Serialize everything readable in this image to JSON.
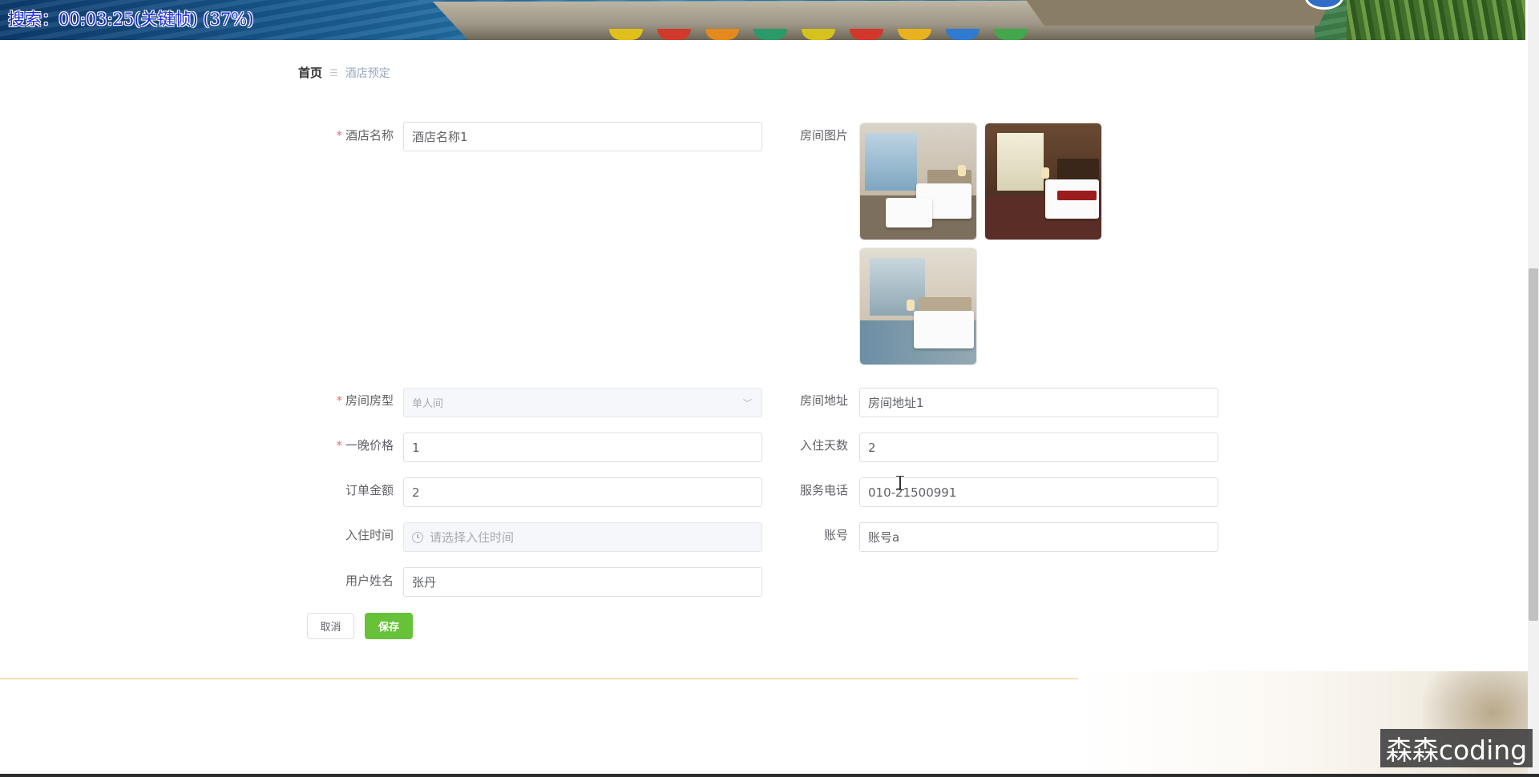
{
  "banner": {
    "overlay_text": "搜索：00:03:25(关键帧) (37%)"
  },
  "breadcrumb": {
    "home": "首页",
    "separator": "☰",
    "current": "酒店预定"
  },
  "form": {
    "hotel_name": {
      "label": "酒店名称",
      "required_mark": "*",
      "value": "酒店名称1"
    },
    "room_images": {
      "label": "房间图片"
    },
    "room_type": {
      "label": "房间房型",
      "required_mark": "*",
      "value": "单人间"
    },
    "room_address": {
      "label": "房间地址",
      "value": "房间地址1"
    },
    "night_price": {
      "label": "一晚价格",
      "required_mark": "*",
      "value": "1"
    },
    "stay_days": {
      "label": "入住天数",
      "value": "2"
    },
    "order_amount": {
      "label": "订单金额",
      "value": "2"
    },
    "service_phone": {
      "label": "服务电话",
      "value": "010-21500991"
    },
    "checkin_time": {
      "label": "入住时间",
      "placeholder": "请选择入住时间"
    },
    "account": {
      "label": "账号",
      "value": "账号a"
    },
    "user_name": {
      "label": "用户姓名",
      "value": "张丹"
    }
  },
  "buttons": {
    "cancel": "取消",
    "save": "保存"
  },
  "watermark": "森森coding",
  "colors": {
    "required": "#f56c6c",
    "save_button": "#67c23a",
    "footer_line": "#f6c377",
    "overlay_text": "#1d2bd6"
  }
}
